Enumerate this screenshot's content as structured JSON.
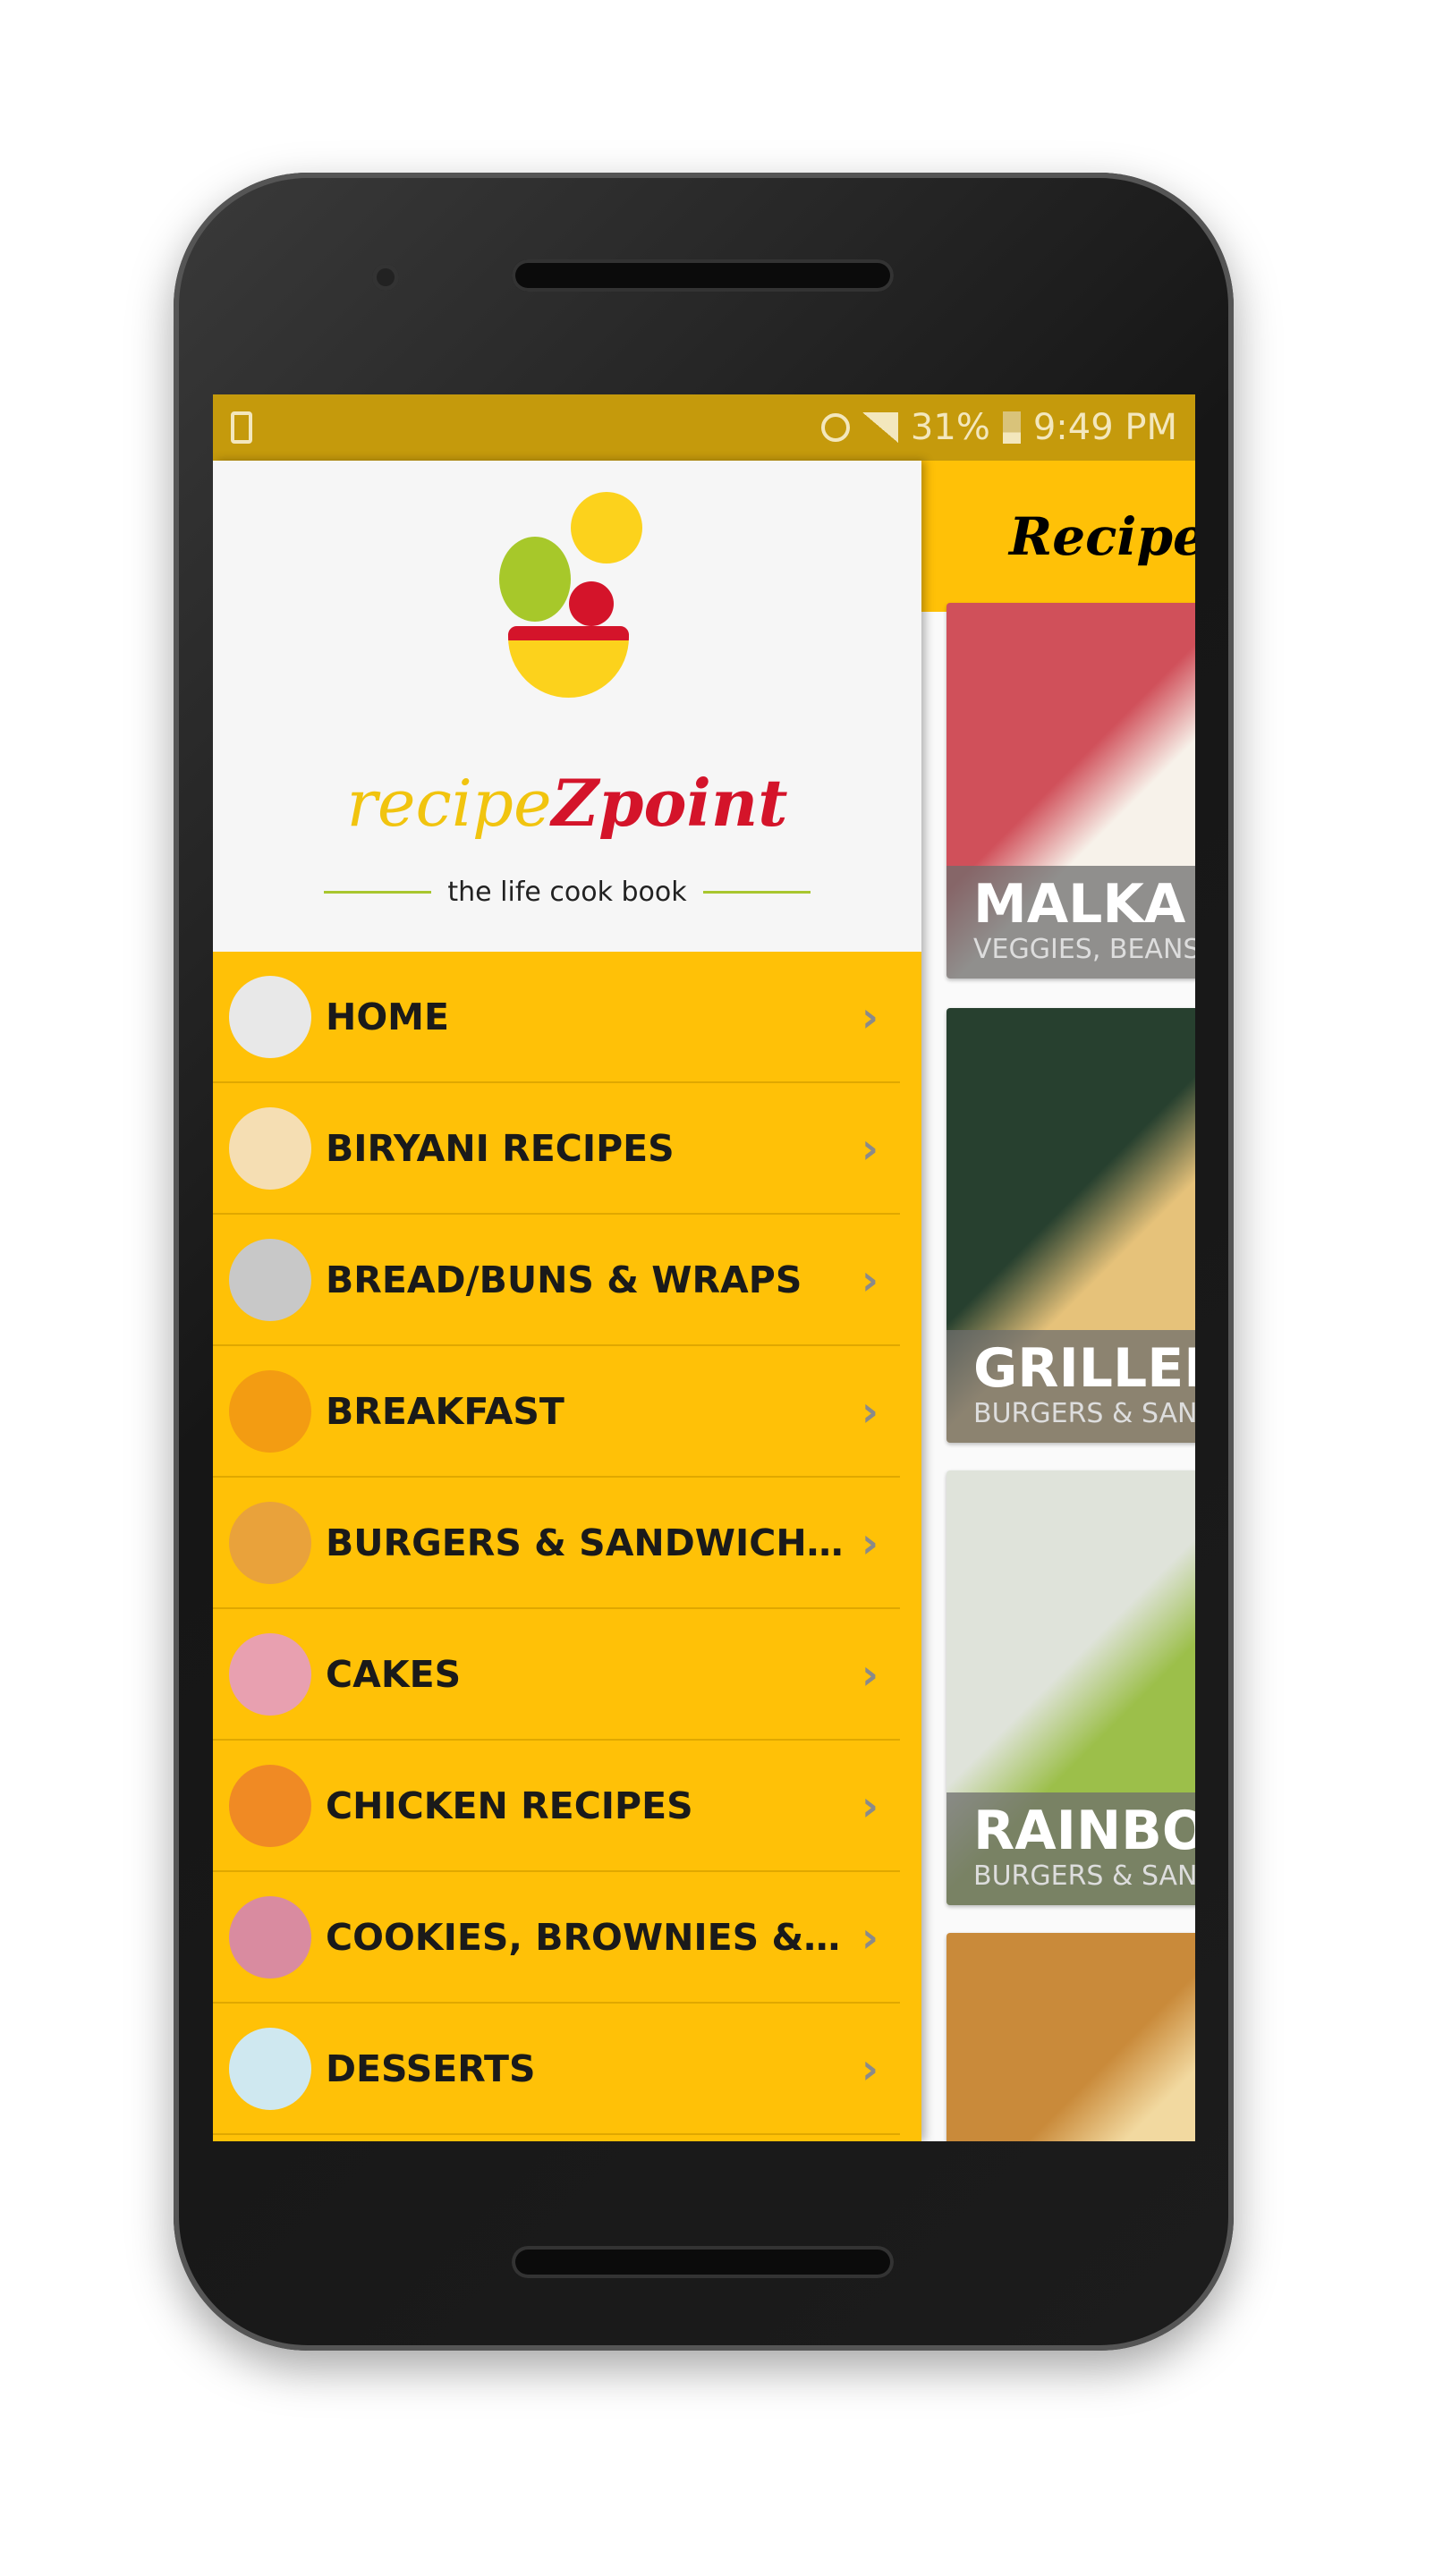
{
  "status_bar": {
    "battery": "31%",
    "time": "9:49 PM",
    "icons": [
      "screenshot-icon",
      "alarm-icon",
      "data-arrows-icon",
      "signal-icon",
      "battery-icon"
    ]
  },
  "drawer": {
    "logo": {
      "name_a": "recipe",
      "name_b": "Zpoint",
      "tagline": "the life cook book"
    },
    "items": [
      {
        "label": "HOME",
        "icon": "house-icon",
        "color": "#e8e8e8"
      },
      {
        "label": "BIRYANI RECIPES",
        "icon": "biryani-plate-icon",
        "color": "#f5deb3"
      },
      {
        "label": "BREAD/BUNS & WRAPS",
        "icon": "wrap-icon",
        "color": "#c8c8c8"
      },
      {
        "label": "BREAKFAST",
        "icon": "toast-egg-icon",
        "color": "#f39c12"
      },
      {
        "label": "BURGERS & SANDWICHES",
        "icon": "burger-icon",
        "color": "#e9a23b"
      },
      {
        "label": "CAKES",
        "icon": "cake-icon",
        "color": "#e8a0b0"
      },
      {
        "label": "CHICKEN RECIPES",
        "icon": "roast-chicken-icon",
        "color": "#f08a24"
      },
      {
        "label": "COOKIES, BROWNIES & DO...",
        "icon": "cookies-donut-icon",
        "color": "#d98ba0"
      },
      {
        "label": "DESSERTS",
        "icon": "ice-cream-icon",
        "color": "#cfe8f0"
      }
    ]
  },
  "appbar": {
    "title": "Recipes",
    "menu_icon": "hamburger-icon"
  },
  "cards": [
    {
      "title": "MALKA M",
      "subtitle": "VEGGIES, BEANS",
      "colors": [
        "#d0505a",
        "#f7f2ea"
      ]
    },
    {
      "title": "GRILLED",
      "subtitle": "BURGERS & SAN",
      "colors": [
        "#27402f",
        "#e6c27a"
      ]
    },
    {
      "title": "RAINBOW",
      "subtitle": "BURGERS & SAN",
      "colors": [
        "#dfe3da",
        "#9cbf4a"
      ]
    },
    {
      "title": "",
      "subtitle": "",
      "colors": [
        "#c98a3a",
        "#f2d9a0"
      ]
    }
  ]
}
